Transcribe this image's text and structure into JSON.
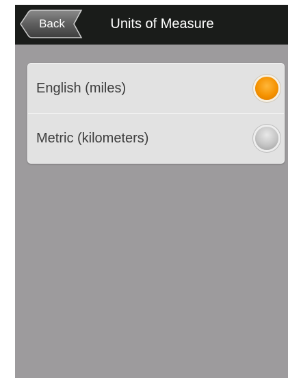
{
  "header": {
    "back_label": "Back",
    "title": "Units of Measure"
  },
  "options": [
    {
      "label": "English (miles)",
      "selected": true
    },
    {
      "label": "Metric (kilometers)",
      "selected": false
    }
  ],
  "colors": {
    "header_bg": "#1a1c1a",
    "page_bg": "#9d9b9d",
    "card_bg": "#e2e2e2",
    "selected_radio": "#f59200",
    "unselected_radio": "#c4c4c4"
  },
  "icons": {
    "selected_radio": "radio-selected-icon",
    "unselected_radio": "radio-unselected-icon"
  }
}
